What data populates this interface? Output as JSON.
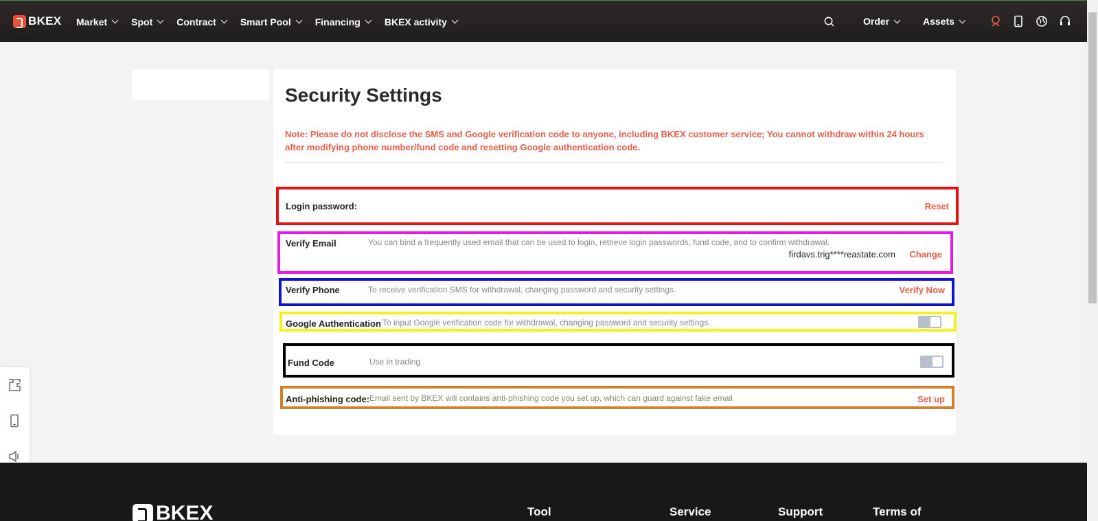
{
  "nav": {
    "logo": "BKEX",
    "items": [
      "Market",
      "Spot",
      "Contract",
      "Smart Pool",
      "Financing",
      "BKEX activity"
    ],
    "order": "Order",
    "assets": "Assets"
  },
  "page": {
    "title": "Security Settings",
    "note": "Note: Please do not disclose the SMS and Google verification code to anyone, including BKEX customer service; You cannot withdraw within 24 hours after modifying phone number/fund code and resetting Google authentication code."
  },
  "rows": {
    "login": {
      "label": "Login password:",
      "action": "Reset"
    },
    "email": {
      "label": "Verify Email",
      "desc": "You can bind a frequently used email that can be used to login, retrieve login passwords, fund code, and to confirm withdrawal.",
      "value": "firdavs.trig****reastate.com",
      "action": "Change"
    },
    "phone": {
      "label": "Verify Phone",
      "desc": "To receive verification SMS for withdrawal, changing password and security settings.",
      "action": "Verify Now"
    },
    "google": {
      "label": "Google Authentication",
      "desc": "To input Google verification code for withdrawal, changing password and security settings."
    },
    "fund": {
      "label": "Fund Code",
      "desc": "Use in trading"
    },
    "phishing": {
      "label": "Anti-phishing code:",
      "desc": "Email sent by BKEX will contains anti-phishing code you set up, which can guard against fake email",
      "action": "Set up"
    }
  },
  "footer": {
    "logo": "BKEX",
    "columns": [
      "Tool",
      "Service",
      "Support",
      "Terms of"
    ]
  },
  "colors": {
    "accent": "#e8604a",
    "navBg": "#262222"
  }
}
